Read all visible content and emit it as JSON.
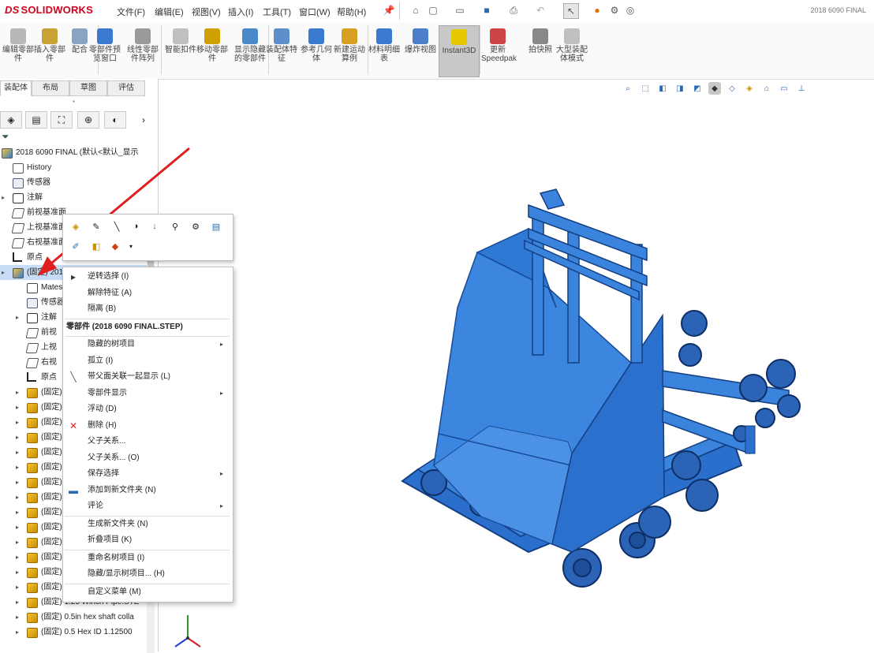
{
  "app": {
    "logo_ds": "DS",
    "logo_text": "SOLIDWORKS",
    "doc_title": "2018 6090 FINAL"
  },
  "menubar": [
    "文件(F)",
    "编辑(E)",
    "视图(V)",
    "插入(I)",
    "工具(T)",
    "窗口(W)",
    "帮助(H)"
  ],
  "ribbon": [
    {
      "label": "编辑零部件",
      "icon": "edit-component-icon"
    },
    {
      "label": "插入零部件",
      "icon": "insert-component-icon"
    },
    {
      "label": "配合",
      "icon": "mate-icon"
    },
    {
      "label": "零部件预览窗口",
      "icon": "preview-window-icon"
    },
    {
      "label": "线性零部件阵列",
      "icon": "linear-pattern-icon"
    },
    {
      "label": "智能扣件",
      "icon": "smart-fastener-icon"
    },
    {
      "label": "移动零部件",
      "icon": "move-component-icon"
    },
    {
      "label": "显示隐藏的零部件",
      "icon": "show-hidden-icon"
    },
    {
      "label": "装配体特征",
      "icon": "assembly-feature-icon"
    },
    {
      "label": "参考几何体",
      "icon": "reference-geometry-icon"
    },
    {
      "label": "新建运动算例",
      "icon": "motion-study-icon"
    },
    {
      "label": "材料明细表",
      "icon": "bom-icon"
    },
    {
      "label": "爆炸视图",
      "icon": "exploded-view-icon"
    },
    {
      "label": "Instant3D",
      "icon": "instant3d-icon"
    },
    {
      "label": "更新Speedpak",
      "icon": "speedpak-icon"
    },
    {
      "label": "拍快照",
      "icon": "snapshot-icon"
    },
    {
      "label": "大型装配体模式",
      "icon": "large-assembly-icon"
    }
  ],
  "panel_tabs": [
    "装配体",
    "布局",
    "草图",
    "评估"
  ],
  "tree": {
    "root": "2018 6090 FINAL (默认<默认_显示",
    "items": [
      {
        "label": "History",
        "icon": "hist"
      },
      {
        "label": "传感器",
        "icon": "sensor"
      },
      {
        "label": "注解",
        "icon": "annot"
      },
      {
        "label": "前视基准面",
        "icon": "plane"
      },
      {
        "label": "上视基准面",
        "icon": "plane"
      },
      {
        "label": "右视基准面",
        "icon": "plane"
      },
      {
        "label": "原点",
        "icon": "origin"
      },
      {
        "label": "(固定) 2018",
        "icon": "assy",
        "selected": true
      },
      {
        "label": "Mates",
        "icon": "mate"
      },
      {
        "label": "传感器",
        "icon": "sensor"
      },
      {
        "label": "注解",
        "icon": "annot"
      },
      {
        "label": "前视",
        "icon": "plane"
      },
      {
        "label": "上视",
        "icon": "plane"
      },
      {
        "label": "右视",
        "icon": "plane"
      },
      {
        "label": "原点",
        "icon": "origin"
      },
      {
        "label": "(固定)",
        "icon": "part"
      },
      {
        "label": "(固定)",
        "icon": "part"
      },
      {
        "label": "(固定)",
        "icon": "part"
      },
      {
        "label": "(固定)",
        "icon": "part"
      },
      {
        "label": "(固定)",
        "icon": "part"
      },
      {
        "label": "(固定)",
        "icon": "part"
      },
      {
        "label": "(固定)",
        "icon": "part"
      },
      {
        "label": "(固定)",
        "icon": "part"
      },
      {
        "label": "(固定)",
        "icon": "part"
      },
      {
        "label": "(固定)",
        "icon": "part"
      },
      {
        "label": "(固定)",
        "icon": "part"
      },
      {
        "label": "(固定)",
        "icon": "part"
      },
      {
        "label": "(固定)",
        "icon": "part"
      },
      {
        "label": "(固定)",
        "icon": "part"
      },
      {
        "label": "(固定) 1.25 Winch Pipe.STE",
        "icon": "part"
      },
      {
        "label": "(固定) 0.5in hex shaft colla",
        "icon": "part"
      },
      {
        "label": "(固定) 0.5 Hex ID 1.12500",
        "icon": "part"
      }
    ]
  },
  "context_menu": [
    {
      "label": "逆转选择 (I)",
      "icon": "select-cursor-icon"
    },
    {
      "label": "解除特征 (A)",
      "icon": ""
    },
    {
      "label": "隔离 (B)",
      "icon": ""
    },
    {
      "label": "零部件 (2018 6090 FINAL.STEP)",
      "header": true
    },
    {
      "label": "隐藏的树项目",
      "submenu": true
    },
    {
      "label": "孤立 (I)",
      "icon": ""
    },
    {
      "label": "带父面关联一起显示 (L)",
      "icon": "show-with-parent-icon"
    },
    {
      "label": "零部件显示",
      "submenu": true
    },
    {
      "label": "浮动 (D)",
      "icon": ""
    },
    {
      "label": "删除 (H)",
      "icon": "delete-icon"
    },
    {
      "label": "父子关系...",
      "icon": ""
    },
    {
      "label": "父子关系... (O)",
      "icon": ""
    },
    {
      "label": "保存选择",
      "submenu": true
    },
    {
      "label": "添加到新文件夹 (N)",
      "icon": "folder-icon"
    },
    {
      "label": "评论",
      "submenu": true
    },
    {
      "label": "生成新文件夹 (N)",
      "icon": ""
    },
    {
      "label": "折叠项目 (K)",
      "icon": ""
    },
    {
      "label": "重命名树项目 (I)",
      "icon": ""
    },
    {
      "label": "隐藏/显示树项目... (H)",
      "icon": ""
    },
    {
      "label": "自定义菜单 (M)",
      "icon": ""
    }
  ],
  "colors": {
    "model_blue": "#2f78d6",
    "model_dark": "#1d4f9a",
    "arrow_red": "#e02020",
    "accent_red": "#d0021b"
  }
}
